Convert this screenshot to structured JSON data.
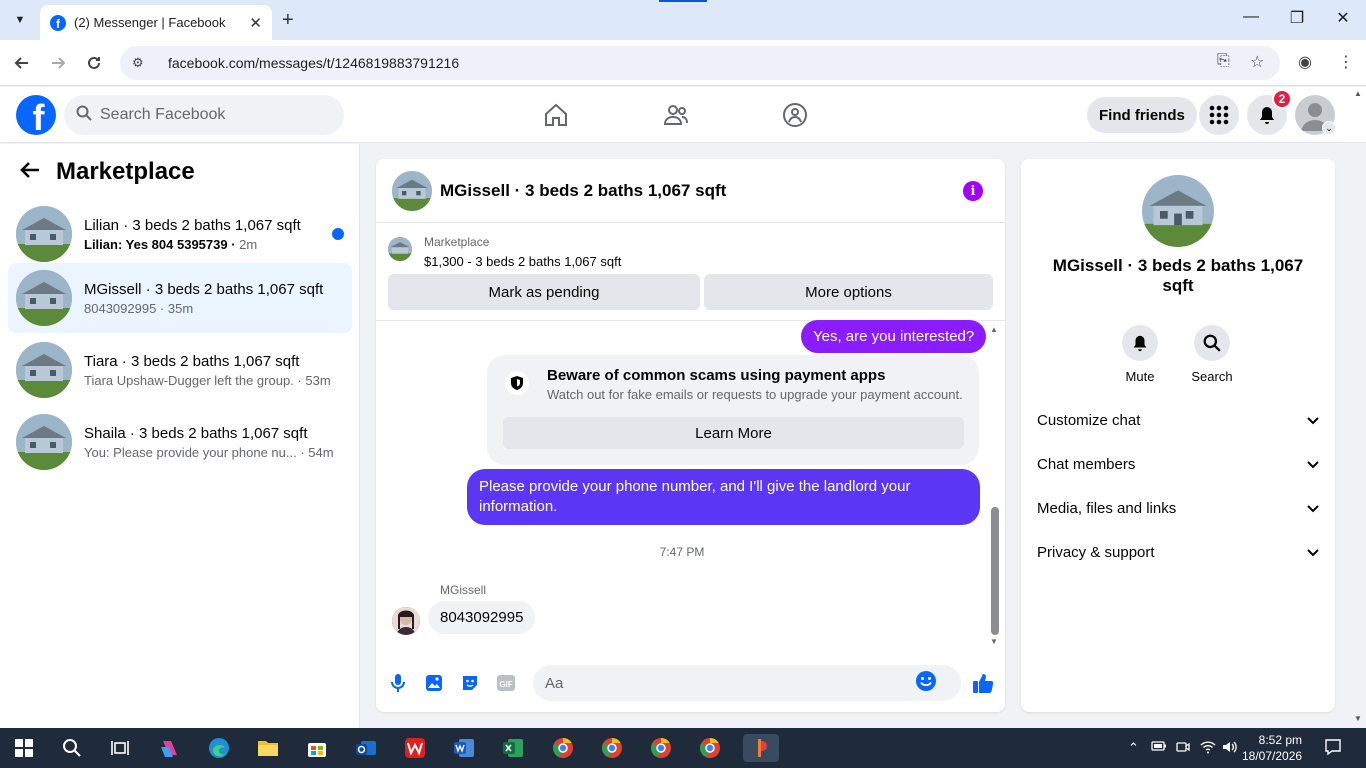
{
  "browser": {
    "tab_title": "(2) Messenger | Facebook",
    "url": "facebook.com/messages/t/1246819883791216"
  },
  "header": {
    "search_placeholder": "Search Facebook",
    "find_friends": "Find friends",
    "notification_count": "2"
  },
  "left": {
    "title": "Marketplace",
    "conversations": [
      {
        "name": "Lilian · 3 beds 2 baths 1,067 sqft",
        "preview": "Lilian: Yes 804 5395739",
        "time": "2m",
        "unread": true
      },
      {
        "name": "MGissell · 3 beds 2 baths 1,067 sqft",
        "preview": "8043092995",
        "time": "35m",
        "active": true
      },
      {
        "name": "Tiara · 3 beds 2 baths 1,067 sqft",
        "preview": "Tiara Upshaw-Dugger left the group.",
        "time": "53m"
      },
      {
        "name": "Shaila · 3 beds 2 baths 1,067 sqft",
        "preview": "You: Please provide your phone nu...",
        "time": "54m"
      }
    ]
  },
  "chat": {
    "title": "MGissell · 3 beds 2 baths 1,067 sqft",
    "marketplace_label": "Marketplace",
    "listing": "$1,300 - 3 beds 2 baths 1,067 sqft",
    "mark_pending": "Mark as pending",
    "more_options": "More options",
    "msg_interested": "Yes, are you interested?",
    "scam_title": "Beware of common scams using payment apps",
    "scam_body": "Watch out for fake emails or requests to upgrade your payment account.",
    "learn_more": "Learn More",
    "msg_phone_line1": "Please provide your phone number, and I'll give the landlord your",
    "msg_phone_line2": "information.",
    "timestamp": "7:47 PM",
    "sender": "MGissell",
    "msg_reply": "8043092995",
    "composer_placeholder": "Aa",
    "gif_label": "GIF"
  },
  "right": {
    "name": "MGissell · 3 beds 2 baths 1,067 sqft",
    "mute": "Mute",
    "search": "Search",
    "sections": [
      "Customize chat",
      "Chat members",
      "Media, files and links",
      "Privacy & support"
    ]
  },
  "taskbar": {
    "time": "8:52 pm",
    "date": "18/07/2026"
  },
  "colors": {
    "fb_blue": "#0866ff",
    "bubble_purple": "#8a1cff",
    "bubble_blue": "#5b37f5",
    "info_purple": "#a100ff"
  }
}
